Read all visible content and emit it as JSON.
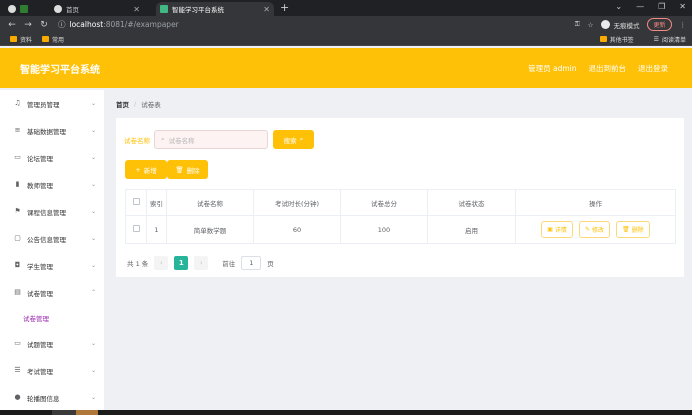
{
  "browser": {
    "tabs": [
      {
        "label": ""
      },
      {
        "label": "首页"
      },
      {
        "label": "智能学习平台系统"
      }
    ],
    "url_host": "localhost",
    "url_path": ":8081/#/exampaper",
    "incognito_label": "无痕模式",
    "update_label": "更新",
    "bookmarks": [
      "资料",
      "常用"
    ],
    "bookmarks_right": [
      "其他书签",
      "阅读清单"
    ]
  },
  "header": {
    "title": "智能学习平台系统",
    "user": "管理员 admin",
    "back_to_front": "退出到前台",
    "logout": "退出登录"
  },
  "sidebar": {
    "items": [
      {
        "label": "管理员管理",
        "icon": "bell-icon"
      },
      {
        "label": "基础数据管理",
        "icon": "list-icon"
      },
      {
        "label": "论坛管理",
        "icon": "monitor-icon"
      },
      {
        "label": "教师管理",
        "icon": "bar-chart-icon"
      },
      {
        "label": "课程信息管理",
        "icon": "flag-icon"
      },
      {
        "label": "公告信息管理",
        "icon": "message-icon"
      },
      {
        "label": "学生管理",
        "icon": "user-badge-icon"
      },
      {
        "label": "试卷管理",
        "icon": "document-icon"
      }
    ],
    "submenu": {
      "label": "试卷管理"
    },
    "items_after": [
      {
        "label": "试题管理",
        "icon": "monitor-icon"
      },
      {
        "label": "考试管理",
        "icon": "sliders-icon"
      },
      {
        "label": "轮播图信息",
        "icon": "person-icon"
      }
    ]
  },
  "breadcrumb": {
    "home": "首页",
    "current": "试卷表"
  },
  "search": {
    "label": "试卷名称",
    "placeholder": "试卷名称",
    "button": "搜索"
  },
  "actions": {
    "add": "新增",
    "delete": "删除"
  },
  "table": {
    "headers": [
      "索引",
      "试卷名称",
      "考试时长(分钟)",
      "试卷总分",
      "试卷状态",
      "操作"
    ],
    "rows": [
      {
        "index": "1",
        "name": "简单数学题",
        "duration": "60",
        "score": "100",
        "status": "启用"
      }
    ],
    "row_actions": {
      "detail": "详情",
      "edit": "修改",
      "delete": "删除"
    }
  },
  "pagination": {
    "total": "共 1 条",
    "page": "1",
    "goto_label": "前往",
    "goto_value": "1",
    "page_suffix": "页"
  },
  "colors": {
    "accent": "#fec107",
    "page_active": "#26b59a"
  }
}
